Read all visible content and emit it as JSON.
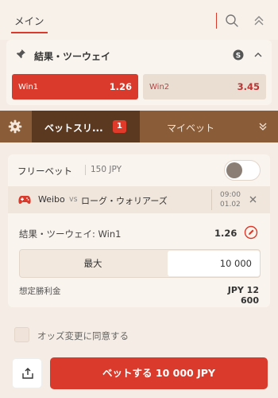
{
  "header": {
    "tab_main": "メイン"
  },
  "market": {
    "title": "結果・ツーウェイ",
    "odds": [
      {
        "label": "Win1",
        "value": "1.26",
        "selected": true
      },
      {
        "label": "Win2",
        "value": "3.45",
        "selected": false
      }
    ]
  },
  "betbar": {
    "tab_betslip": "ベットスリ...",
    "betslip_count": "1",
    "tab_mybets": "マイベット"
  },
  "slip": {
    "freebet_label": "フリーベット",
    "freebet_amount": "150 JPY",
    "event": {
      "team1": "Weibo",
      "vs": "vs",
      "team2": "ローグ・ウォリアーズ",
      "time": "09:00",
      "date": "01.02"
    },
    "selection": "結果・ツーウェイ: Win1",
    "selection_odds": "1.26",
    "max_label": "最大",
    "stake_value": "10 000",
    "potential_win_label": "想定勝利金",
    "potential_win_value": "JPY 12 600"
  },
  "footer": {
    "accept_odds_label": "オッズ変更に同意する",
    "place_bet_label": "ベットする 10 000 JPY"
  },
  "colors": {
    "accent": "#d93a2b",
    "brown": "#8a5c37",
    "dark_brown": "#5b3920",
    "background": "#f5ede5"
  }
}
